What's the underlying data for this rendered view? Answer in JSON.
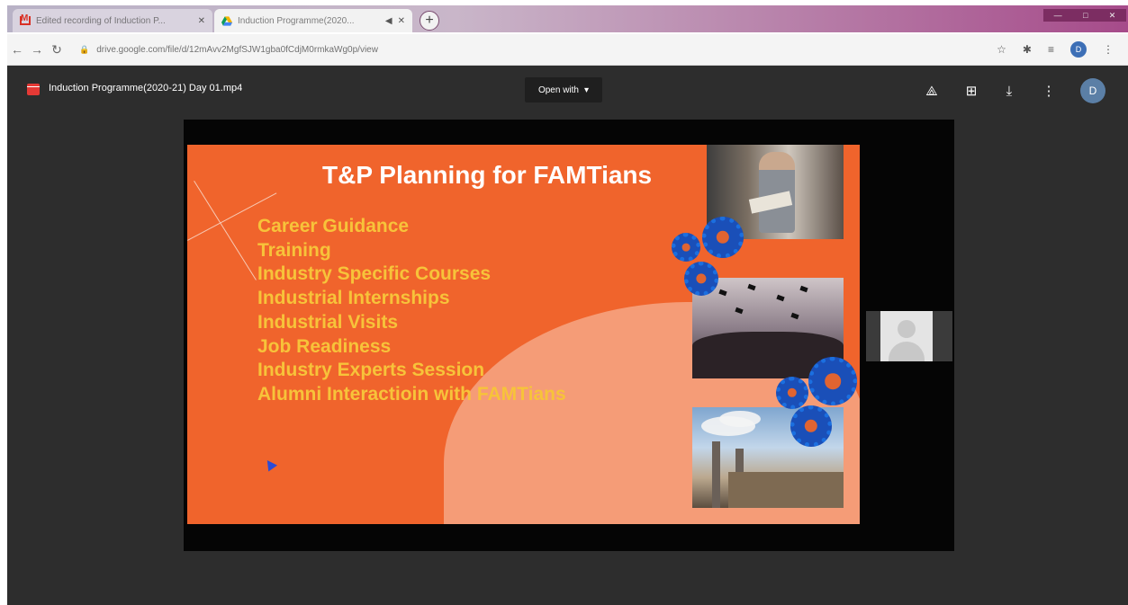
{
  "browser": {
    "tabs": [
      {
        "title": "Edited recording of Induction P...",
        "icon": "gmail-icon"
      },
      {
        "title": "Induction Programme(2020...",
        "icon": "drive-icon"
      }
    ],
    "url": "drive.google.com/file/d/12mAvv2MgfSJW1gba0fCdjM0rmkaWg0p/view",
    "profile_initial": "D"
  },
  "viewer": {
    "file_name": "Induction Programme(2020-21) Day 01.mp4",
    "open_with_label": "Open with",
    "profile_initial": "D"
  },
  "slide": {
    "title": "T&P Planning for FAMTians",
    "bullets": [
      "Career Guidance",
      "Training",
      "Industry Specific Courses",
      "Industrial Internships",
      "Industrial Visits",
      "Job Readiness",
      "Industry Experts Session",
      "Alumni Interactioin with FAMTians"
    ]
  },
  "colors": {
    "slide_background": "#f0642c",
    "bullet_text": "#f7c33a",
    "gear": "#1a4fb8",
    "viewer_background": "#2d2d2d"
  }
}
